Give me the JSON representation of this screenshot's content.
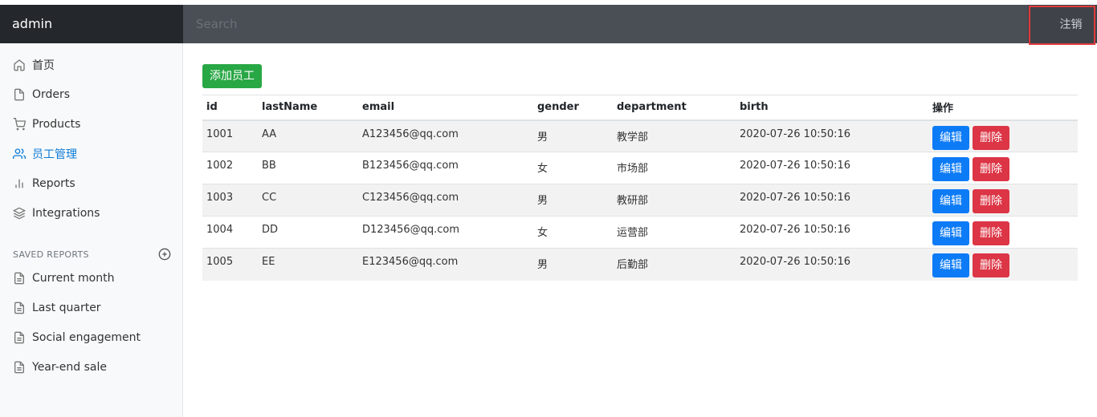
{
  "navbar": {
    "brand": "admin",
    "search_placeholder": "Search",
    "signout_label": "注销"
  },
  "sidebar": {
    "items": [
      {
        "label": "首页",
        "icon": "home-icon"
      },
      {
        "label": "Orders",
        "icon": "file-icon"
      },
      {
        "label": "Products",
        "icon": "shopping-cart-icon"
      },
      {
        "label": "员工管理",
        "icon": "users-icon",
        "active": true
      },
      {
        "label": "Reports",
        "icon": "bar-chart-icon"
      },
      {
        "label": "Integrations",
        "icon": "layers-icon"
      }
    ],
    "saved_reports_title": "SAVED REPORTS",
    "saved_reports": [
      {
        "label": "Current month"
      },
      {
        "label": "Last quarter"
      },
      {
        "label": "Social engagement"
      },
      {
        "label": "Year-end sale"
      }
    ]
  },
  "main": {
    "add_button_label": "添加员工",
    "columns": [
      "id",
      "lastName",
      "email",
      "gender",
      "department",
      "birth",
      "操作"
    ],
    "rows": [
      {
        "id": "1001",
        "lastName": "AA",
        "email": "A123456@qq.com",
        "gender": "男",
        "department": "教学部",
        "birth": "2020-07-26 10:50:16"
      },
      {
        "id": "1002",
        "lastName": "BB",
        "email": "B123456@qq.com",
        "gender": "女",
        "department": "市场部",
        "birth": "2020-07-26 10:50:16"
      },
      {
        "id": "1003",
        "lastName": "CC",
        "email": "C123456@qq.com",
        "gender": "男",
        "department": "教研部",
        "birth": "2020-07-26 10:50:16"
      },
      {
        "id": "1004",
        "lastName": "DD",
        "email": "D123456@qq.com",
        "gender": "女",
        "department": "运营部",
        "birth": "2020-07-26 10:50:16"
      },
      {
        "id": "1005",
        "lastName": "EE",
        "email": "E123456@qq.com",
        "gender": "男",
        "department": "后勤部",
        "birth": "2020-07-26 10:50:16"
      }
    ],
    "edit_label": "编辑",
    "delete_label": "删除"
  },
  "colors": {
    "active_nav": "#0d7bd8",
    "add_button": "#28a745",
    "edit_button": "#0d7bf6",
    "delete_button": "#dc3545",
    "highlight_box": "#e03b3b"
  }
}
